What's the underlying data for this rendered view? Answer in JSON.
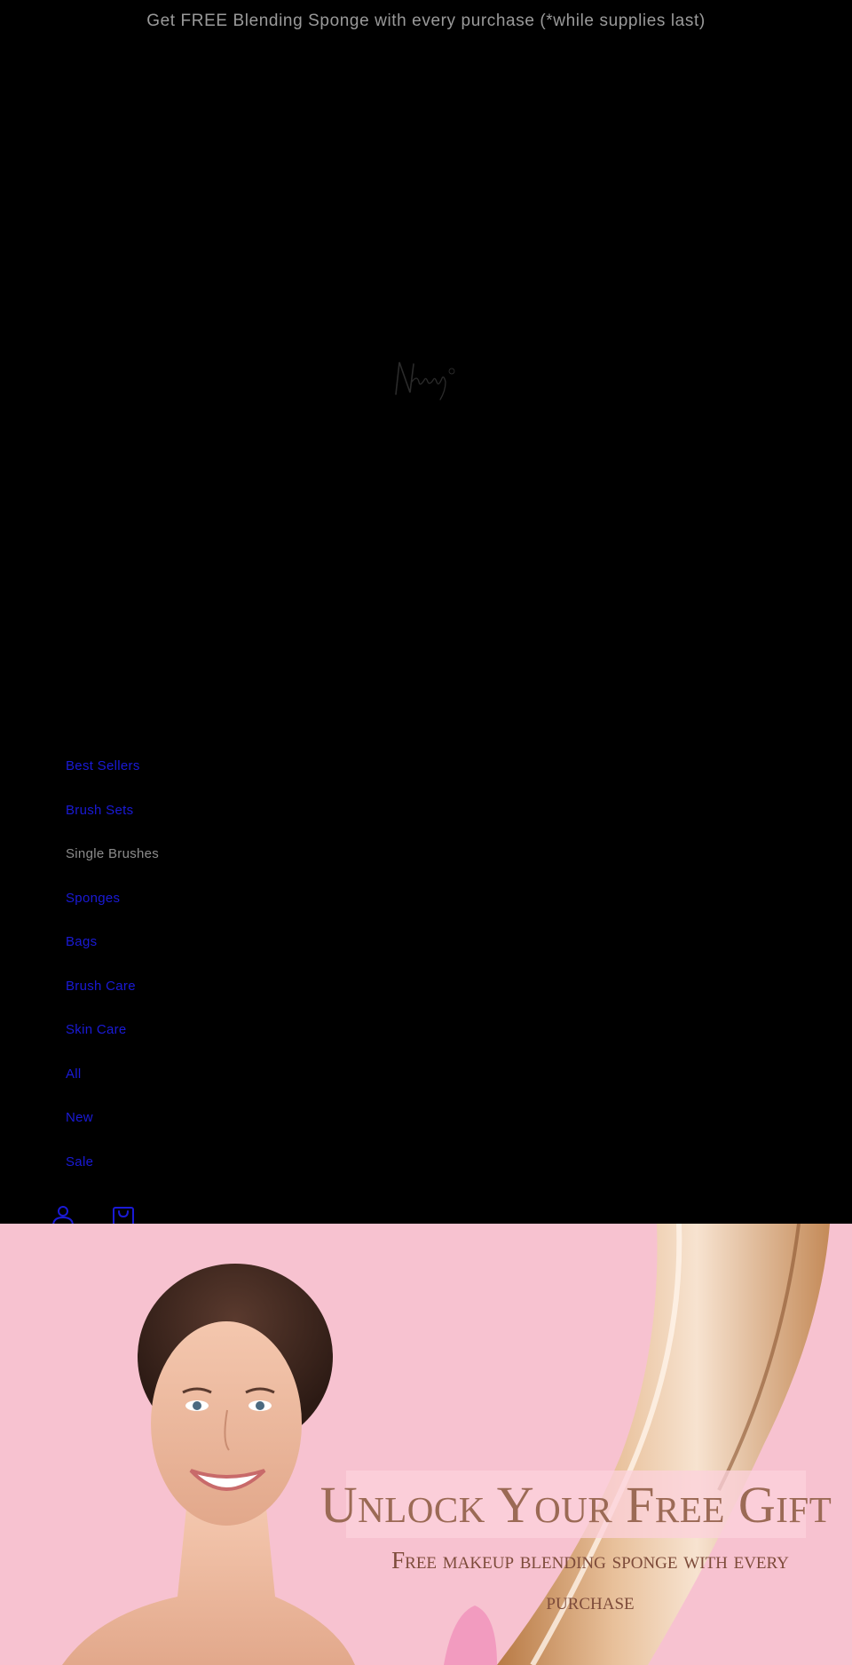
{
  "announcement": {
    "text": "Get FREE Blending Sponge with every purchase (*while supplies last)"
  },
  "header": {
    "logo_text": "Nanshy",
    "nav": [
      {
        "label": "Best Sellers",
        "current": false
      },
      {
        "label": "Brush Sets",
        "current": false
      },
      {
        "label": "Single Brushes",
        "current": true
      },
      {
        "label": "Sponges",
        "current": false
      },
      {
        "label": "Bags",
        "current": false
      },
      {
        "label": "Brush Care",
        "current": false
      },
      {
        "label": "Skin Care",
        "current": false
      },
      {
        "label": "All",
        "current": false
      },
      {
        "label": "New",
        "current": false
      },
      {
        "label": "Sale",
        "current": false
      }
    ],
    "icons": [
      "account-icon",
      "cart-icon"
    ]
  },
  "hero": {
    "title": "Unlock Your Free Gift",
    "subtitle": "Free makeup blending sponge with every purchase"
  },
  "colors": {
    "background": "#000000",
    "announcement_text": "#9a9a9a",
    "nav_link": "#1a1ad6",
    "nav_current": "#8c8c8c",
    "hero_bg": "#f7c2d0",
    "hero_title": "#9b6a55",
    "hero_subtitle": "#7d4b3a"
  }
}
